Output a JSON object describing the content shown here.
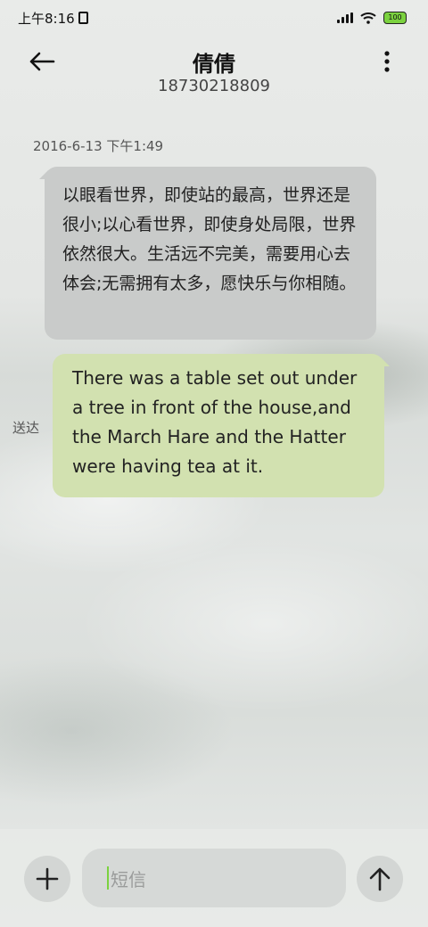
{
  "status_bar": {
    "time": "上午8:16",
    "battery": "100"
  },
  "header": {
    "contact_name": "倩倩",
    "contact_number": "18730218809"
  },
  "conversation": {
    "timestamp": "2016-6-13 下午1:49",
    "incoming_message": "以眼看世界，即使站的最高，世界还是很小;以心看世界，即使身处局限，世界依然很大。生活远不完美，需要用心去体会;无需拥有太多，愿快乐与你相随。",
    "outgoing_message": "There was a table set out under a tree in front of the house,and the March Hare and the Hatter were having tea at it.",
    "outgoing_status": "送达"
  },
  "composer": {
    "placeholder": "短信"
  },
  "colors": {
    "incoming_bubble": "#c9cbca",
    "outgoing_bubble": "#d2e1b0",
    "accent": "#7bd23f"
  },
  "icons": [
    "vibrate-icon",
    "signal-icon",
    "wifi-icon",
    "battery-icon",
    "back-arrow-icon",
    "more-vert-icon",
    "plus-icon",
    "send-arrow-icon"
  ]
}
